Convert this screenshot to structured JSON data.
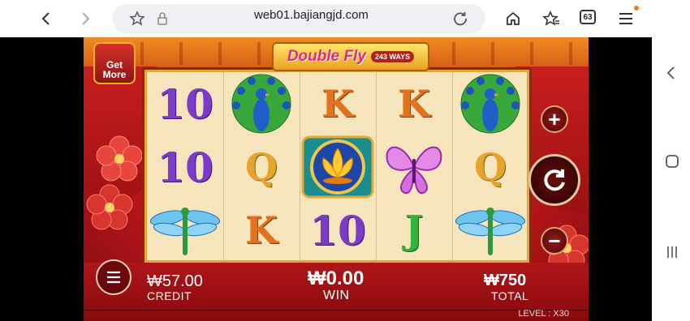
{
  "browser": {
    "url": "web01.bajiangjd.com",
    "tabs_count": "63",
    "icons": [
      "back-arrow-icon",
      "forward-arrow-icon",
      "star-icon",
      "lock-icon",
      "reload-icon",
      "home-icon",
      "bookmarks-icon",
      "tabs-icon",
      "menu-icon"
    ]
  },
  "system_nav": {
    "icons": [
      "back-chevron-icon",
      "home-square-icon",
      "recents-icon"
    ]
  },
  "game": {
    "title": "Double Fly",
    "ways": "243 WAYS",
    "get_more": "Get More",
    "reels": [
      [
        "10",
        "10",
        "dragonfly"
      ],
      [
        "peacock",
        "Q",
        "K"
      ],
      [
        "K",
        "lotus",
        "10"
      ],
      [
        "K",
        "butterfly",
        "J"
      ],
      [
        "peacock",
        "Q",
        "dragonfly"
      ]
    ],
    "credit": {
      "value": "₩57.00",
      "label": "CREDIT"
    },
    "win": {
      "value": "₩0.00",
      "label": "WIN"
    },
    "total": {
      "value": "₩750",
      "label": "TOTAL"
    },
    "level": "LEVEL : X30",
    "colors": {
      "accent_red": "#b3151a",
      "gold": "#e1a93a",
      "reel_bg": "#f6e4bd"
    }
  }
}
